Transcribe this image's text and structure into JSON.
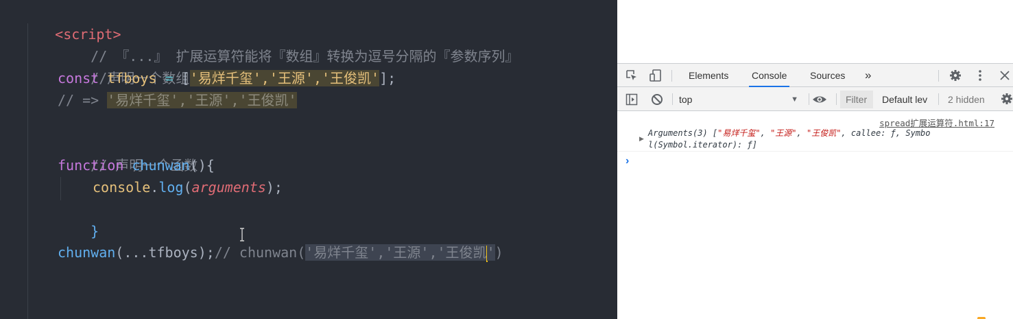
{
  "editor": {
    "lines": {
      "l1": {
        "tag": "<script>"
      },
      "l2": {
        "comment": "// 『...』 扩展运算符能将『数组』转换为逗号分隔的『参数序列』"
      },
      "l3": {
        "comment": "//声明一个数组 ..."
      },
      "l4": {
        "kw": "const",
        "name": "tfboys",
        "eq": "=",
        "open": "[",
        "s1": "'易烊千玺'",
        "c1": ",",
        "s2": "'王源'",
        "c2": ",",
        "s3": "'王俊凯'",
        "close": "];"
      },
      "l5": {
        "prefix": "// => ",
        "hl": "'易烊千玺','王源','王俊凯'"
      },
      "l7": {
        "comment": "// 声明一个函数"
      },
      "l8": {
        "kw": "function",
        "name": "chunwan",
        "rest": "(){"
      },
      "l9": {
        "obj": "console",
        "dot": ".",
        "method": "log",
        "open": "(",
        "arg": "arguments",
        "close": ");"
      },
      "l10": {
        "brace": "}"
      },
      "l12": {
        "call": "chunwan",
        "open": "(",
        "spread": "...tfboys",
        "close": ");",
        "comment_pre": "// chunwan(",
        "comment_sel": "'易烊千玺','王源','王俊凯",
        "comment_after_caret": "'",
        "comment_end": ")"
      }
    }
  },
  "devtools": {
    "tabs": [
      "Elements",
      "Console",
      "Sources"
    ],
    "active_tab": "Console",
    "more_tabs": "»",
    "context": "top",
    "filter_placeholder": "Filter",
    "levels": "Default lev",
    "hidden": "2 hidden",
    "message": {
      "source": "spread扩展运算符.html:17",
      "prefix": "Arguments(3) [",
      "s1": "\"易烊千玺\"",
      "sep1": ", ",
      "s2": "\"王源\"",
      "sep2": ", ",
      "s3": "\"王俊凯\"",
      "rest1": ", callee: ƒ, Symbo",
      "rest2": "l(Symbol.iterator): ƒ]"
    },
    "prompt": "›"
  }
}
